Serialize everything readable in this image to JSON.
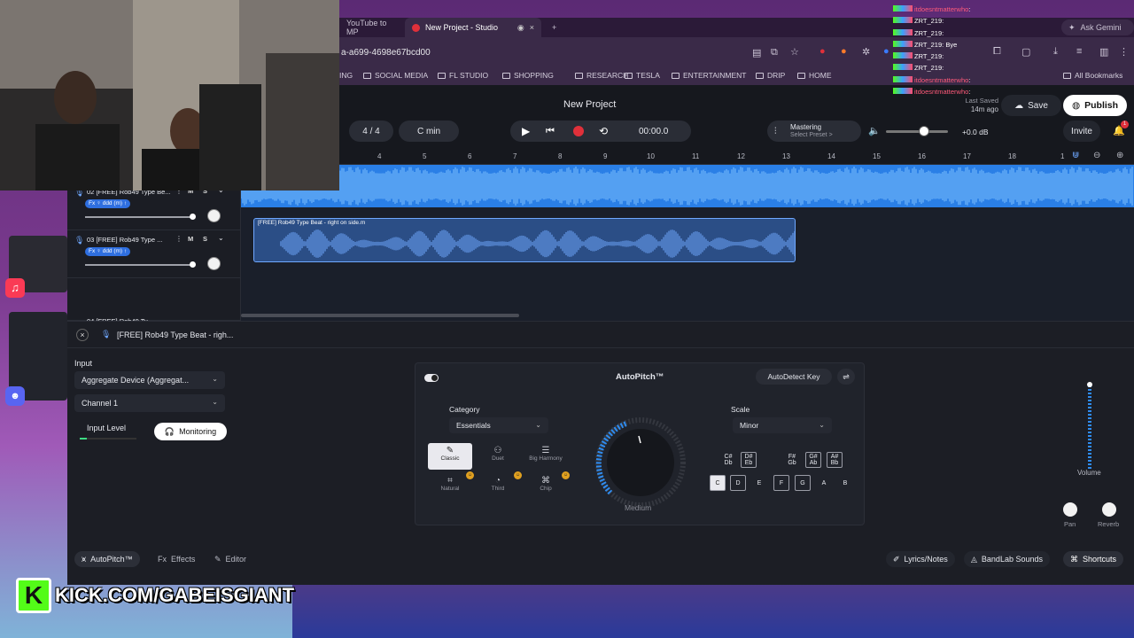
{
  "browser": {
    "tabs": [
      {
        "title": "YouTube to MP",
        "active": false
      },
      {
        "title": "New Project - Studio",
        "active": true
      }
    ],
    "url": "a-a699-4698e67bcd00",
    "ask_gemini": "Ask Gemini",
    "bookmarks": [
      "ING",
      "SOCIAL MEDIA",
      "FL STUDIO",
      "SHOPPING",
      "RESEARCH",
      "TESLA",
      "ENTERTAINMENT",
      "DRIP",
      "HOME"
    ],
    "all_bookmarks": "All Bookmarks"
  },
  "studio": {
    "project_title": "New Project",
    "last_saved_label": "Last Saved",
    "last_saved_value": "14m ago",
    "save_label": "Save",
    "publish_label": "Publish",
    "invite_label": "Invite",
    "notification_count": "1",
    "time_signature": "4 / 4",
    "key": "C min",
    "time_display": "00:00.0",
    "mastering_label": "Mastering",
    "mastering_preset": "Select Preset >",
    "master_gain": "+0.0 dB",
    "ruler_ticks": [
      "4",
      "5",
      "6",
      "7",
      "8",
      "9",
      "10",
      "11",
      "12",
      "13",
      "14",
      "15",
      "16",
      "17",
      "18",
      "1"
    ],
    "tracks": [
      {
        "number": "02",
        "name": "[FREE] Rob49 Type Be...",
        "fx": "Fx ♀ ddd (m) ↑"
      },
      {
        "number": "03",
        "name": "[FREE] Rob49 Type ...",
        "fx": "Fx ♀ ddd (m) ↑"
      },
      {
        "number": "04",
        "name": "[FREE] Rob49 Ty...",
        "fx": ""
      }
    ],
    "mute": "M",
    "solo": "S",
    "clip_name": "[FREE] Rob49 Type Beat - right on side.m"
  },
  "editor": {
    "title": "[FREE] Rob49 Type Beat - righ...",
    "input_label": "Input",
    "device": "Aggregate Device (Aggregat...",
    "channel": "Channel 1",
    "input_level_label": "Input Level",
    "monitoring_label": "Monitoring",
    "autopitch": {
      "title": "AutoPitch™",
      "autodetect_label": "AutoDetect Key",
      "category_label": "Category",
      "category_value": "Essentials",
      "modes": [
        "Classic",
        "Duet",
        "Big Harmony",
        "Natural",
        "Third",
        "Chip"
      ],
      "dial_label": "Medium",
      "scale_label": "Scale",
      "scale_value": "Minor",
      "keys_top": [
        "C#\nDb",
        "D#\nEb",
        "F#\nGb",
        "G#\nAb",
        "A#\nBb"
      ],
      "keys_bottom": [
        "C",
        "D",
        "E",
        "F",
        "G",
        "A",
        "B"
      ]
    },
    "volume_label": "Volume",
    "pan_label": "Pan",
    "reverb_label": "Reverb",
    "tabs": [
      "AutoPitch™",
      "Effects",
      "Editor"
    ],
    "right_tabs": [
      "Lyrics/Notes",
      "BandLab Sounds",
      "Shortcuts"
    ]
  },
  "stream": {
    "kick_label": "KICK.COM/GABEISGIANT",
    "chat": [
      {
        "user": "itdoesntmatterwho",
        "msg": ""
      },
      {
        "user": "ZRT_219",
        "msg": ""
      },
      {
        "user": "ZRT_219",
        "msg": ""
      },
      {
        "user": "ZRT_219",
        "msg": "Bye"
      },
      {
        "user": "ZRT_219",
        "msg": ""
      },
      {
        "user": "ZRT_219",
        "msg": ""
      },
      {
        "user": "itdoesntmatterwho",
        "msg": ""
      },
      {
        "user": "itdoesntmatterwho",
        "msg": ""
      }
    ]
  },
  "colors": {
    "accent_blue": "#2f8cf0",
    "record_red": "#e0303a",
    "kick_green": "#53fc18"
  }
}
